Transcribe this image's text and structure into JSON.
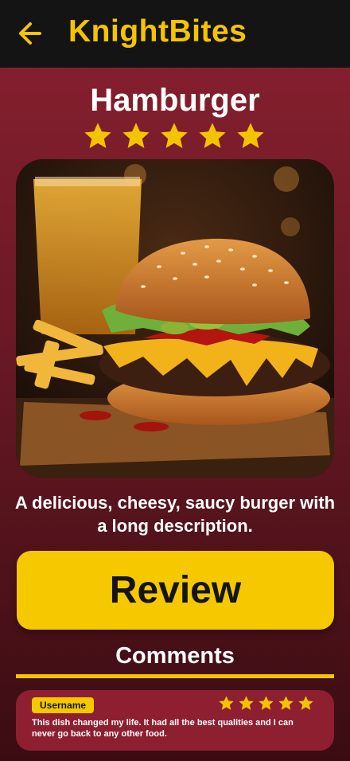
{
  "header": {
    "app_name": "KnightBites"
  },
  "dish": {
    "title": "Hamburger",
    "rating": 5,
    "description": "A delicious, cheesy, saucy burger with a long description."
  },
  "actions": {
    "review_label": "Review"
  },
  "comments": {
    "heading": "Comments",
    "items": [
      {
        "username": "Username",
        "rating": 5,
        "text": "This dish changed my life. It had all the best qualities and I can never go back to any other food."
      }
    ]
  },
  "colors": {
    "accent": "#f5c400",
    "header_bg": "#141414",
    "card": "#8e1f30"
  }
}
